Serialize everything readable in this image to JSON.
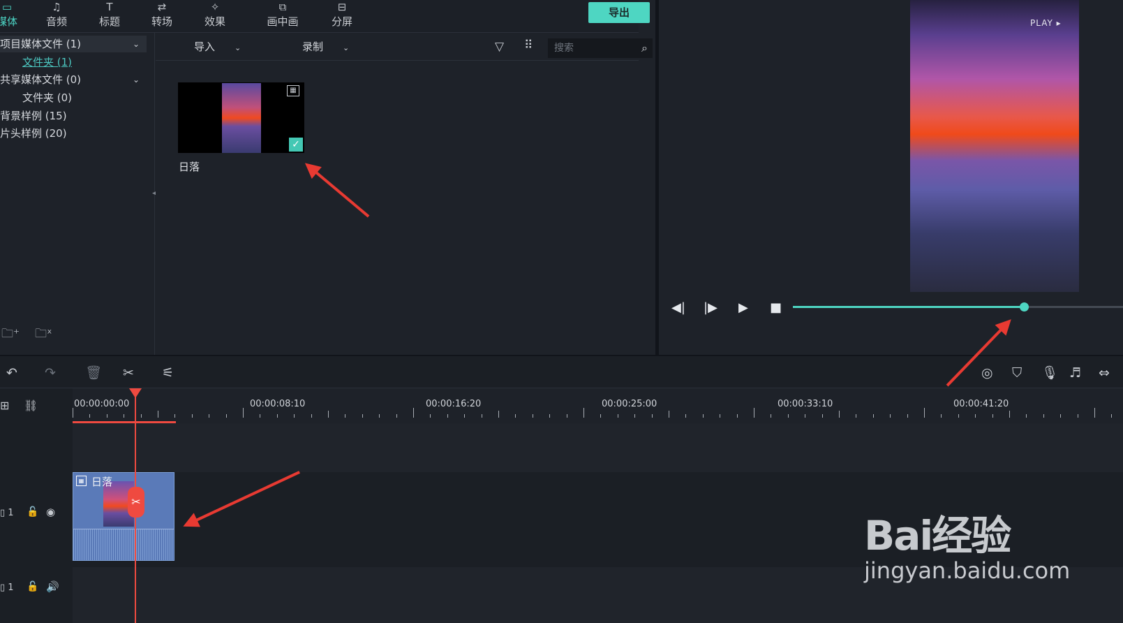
{
  "tabs": [
    {
      "label": "媒体",
      "icon": "folder-icon"
    },
    {
      "label": "音频",
      "icon": "music-note-icon"
    },
    {
      "label": "标题",
      "icon": "text-title-icon"
    },
    {
      "label": "转场",
      "icon": "transition-icon"
    },
    {
      "label": "效果",
      "icon": "effects-icon"
    },
    {
      "label": "画中画",
      "icon": "pip-icon"
    },
    {
      "label": "分屏",
      "icon": "split-screen-icon"
    }
  ],
  "export_label": "导出",
  "tree": [
    {
      "label": "项目媒体文件 (1)"
    },
    {
      "label": "文件夹 (1)"
    },
    {
      "label": "共享媒体文件 (0)"
    },
    {
      "label": "文件夹 (0)"
    },
    {
      "label": "背景样例 (15)"
    },
    {
      "label": "片头样例 (20)"
    }
  ],
  "media_toolbar": {
    "import_label": "导入",
    "record_label": "录制",
    "search_placeholder": "搜索"
  },
  "media_items": [
    {
      "name": "日落",
      "selected": true
    }
  ],
  "preview": {
    "play_tag": "PLAY",
    "progress": 0.7
  },
  "ruler": {
    "labels": [
      "00:00:00:00",
      "00:00:08:10",
      "00:00:16:20",
      "00:00:25:00",
      "00:00:33:10",
      "00:00:41:20"
    ]
  },
  "tracks": {
    "video_label": "1",
    "audio_label": "1",
    "clip_name": "日落"
  },
  "watermark": {
    "brand": "Bai经验",
    "url": "jingyan.baidu.com"
  },
  "colors": {
    "accent": "#4ed6c2",
    "playhead": "#ef4a40",
    "clip": "#5a7ab8"
  }
}
